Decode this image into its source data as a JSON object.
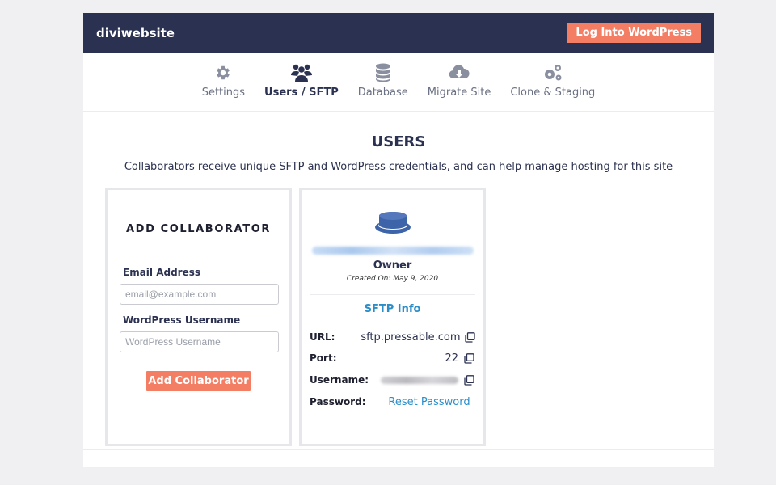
{
  "header": {
    "site_name": "diviwebsite",
    "login_label": "Log Into WordPress"
  },
  "tabs": [
    {
      "label": "Settings",
      "icon": "gear-icon"
    },
    {
      "label": "Users / SFTP",
      "icon": "users-icon",
      "active": true
    },
    {
      "label": "Database",
      "icon": "database-icon"
    },
    {
      "label": "Migrate Site",
      "icon": "cloud-download-icon"
    },
    {
      "label": "Clone & Staging",
      "icon": "gears-icon"
    }
  ],
  "users": {
    "title": "USERS",
    "subtitle": "Collaborators receive unique SFTP and WordPress credentials, and can help manage hosting for this site"
  },
  "add_collaborator": {
    "title": "ADD COLLABORATOR",
    "email_label": "Email Address",
    "email_placeholder": "email@example.com",
    "username_label": "WordPress Username",
    "username_placeholder": "WordPress Username",
    "button_label": "Add Collaborator"
  },
  "user_card": {
    "role": "Owner",
    "created": "Created On: May 9, 2020",
    "sftp_title": "SFTP Info",
    "url_label": "URL:",
    "url_value": "sftp.pressable.com",
    "port_label": "Port:",
    "port_value": "22",
    "username_label": "Username:",
    "password_label": "Password:",
    "reset_label": "Reset Password"
  },
  "colors": {
    "navy": "#2b3150",
    "accent": "#f47e64",
    "link": "#2b8ec9",
    "avatar": "#3d63a8"
  }
}
